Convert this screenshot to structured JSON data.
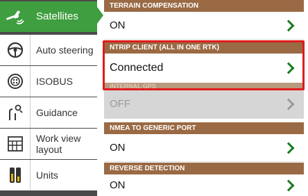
{
  "sidebar": {
    "items": [
      {
        "label": "Satellites",
        "icon": "satellite-icon",
        "active": true
      },
      {
        "label": "Auto steering",
        "icon": "steering-wheel-icon"
      },
      {
        "label": "ISOBUS",
        "icon": "isobus-icon"
      },
      {
        "label": "Guidance",
        "icon": "guidance-icon"
      },
      {
        "label": "Work view layout",
        "icon": "layout-grid-icon"
      },
      {
        "label": "Units",
        "icon": "units-icon"
      }
    ]
  },
  "settings": {
    "terrain": {
      "header": "TERRAIN COMPENSATION",
      "value": "ON"
    },
    "ntrip": {
      "header": "NTRIP CLIENT (ALL IN ONE RTK)",
      "value": "Connected"
    },
    "internal_gps": {
      "header": "INTERNAL GPS",
      "value": "OFF"
    },
    "nmea": {
      "header": "NMEA TO GENERIC PORT",
      "value": "ON"
    },
    "reverse": {
      "header": "REVERSE DETECTION",
      "value": "ON"
    }
  },
  "colors": {
    "active_green": "#3f9e3f",
    "section_brown": "#9a6a44",
    "chevron_green": "#1c7a22",
    "highlight_red": "#e01b1b"
  }
}
